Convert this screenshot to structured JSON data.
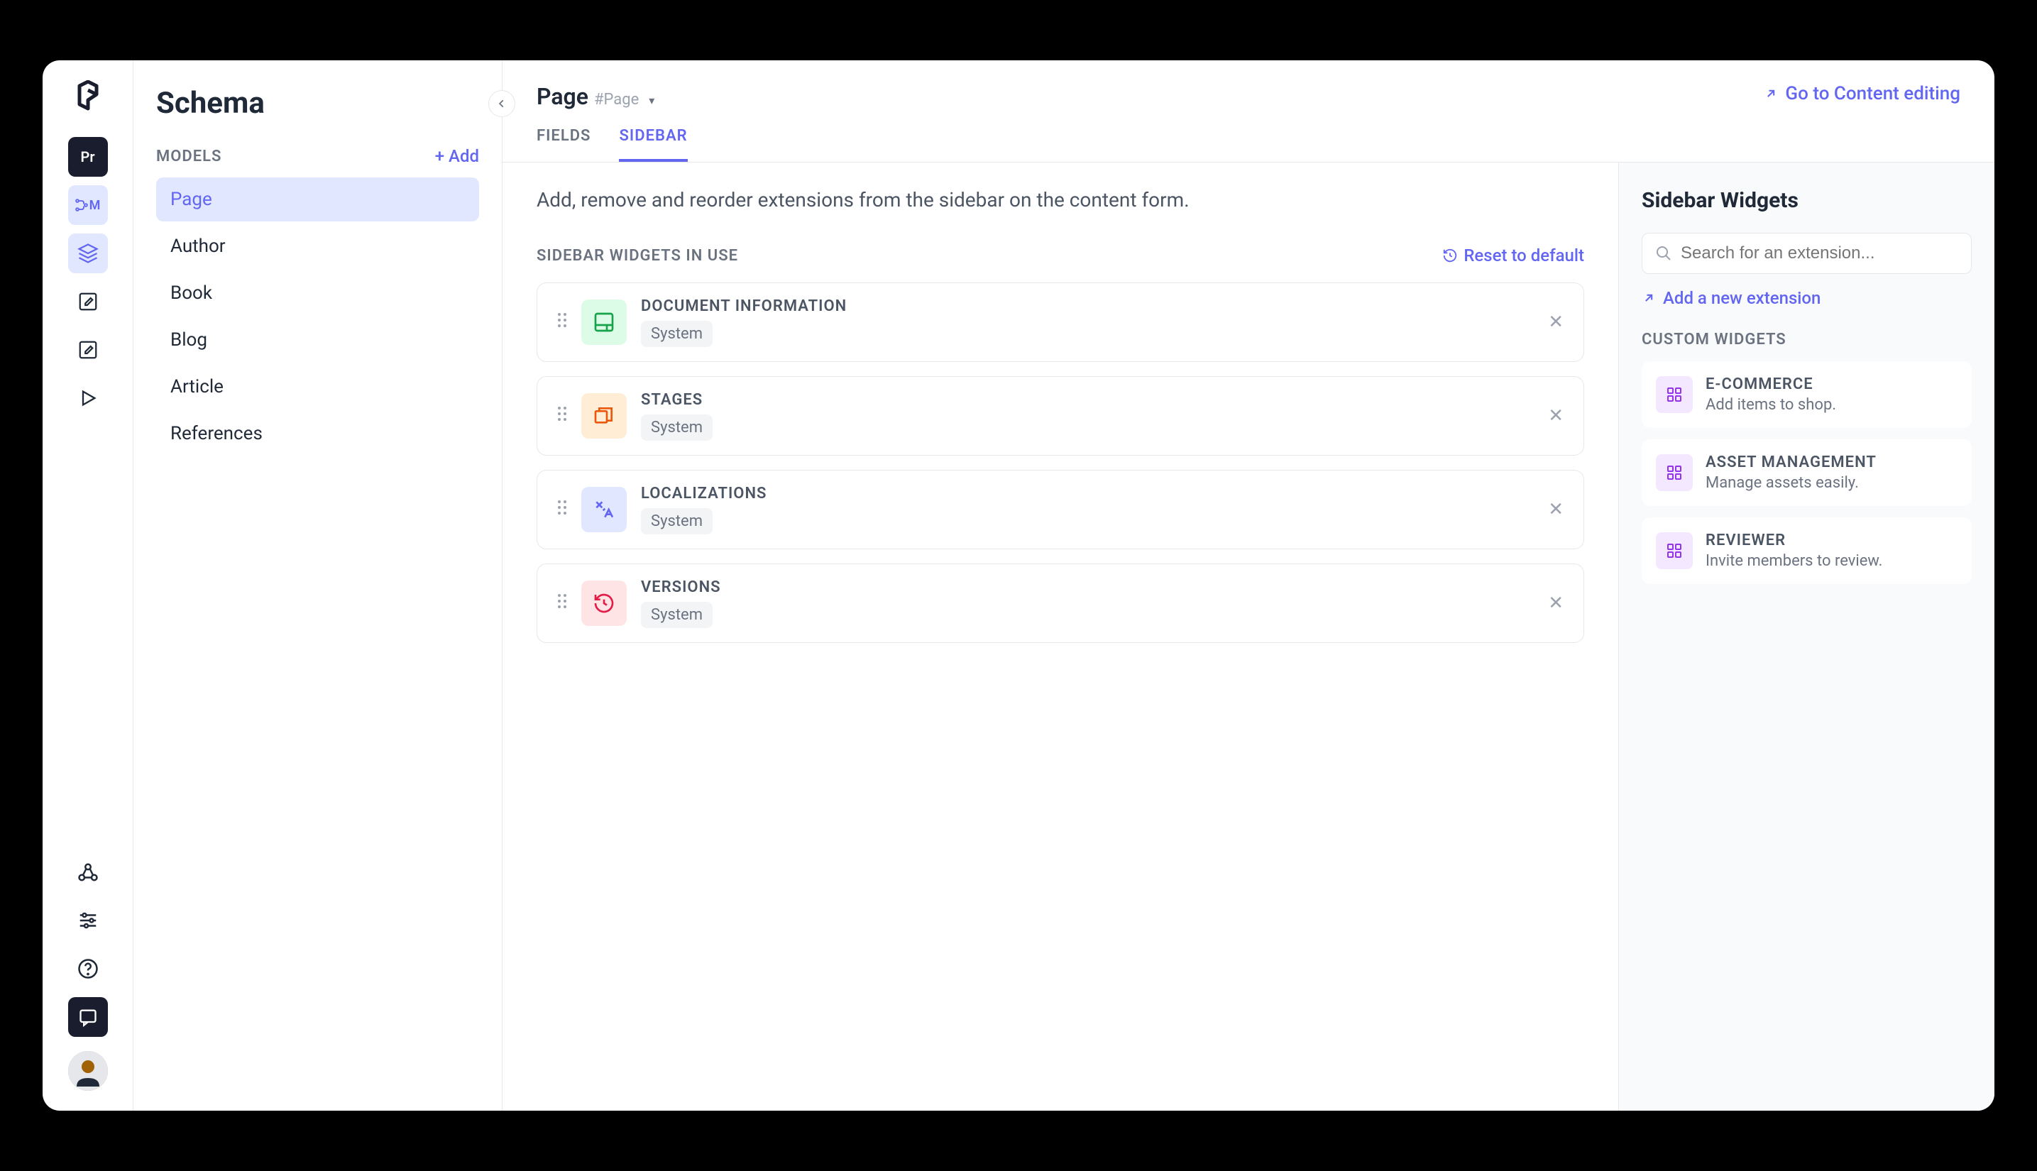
{
  "page_title": "Schema",
  "nav_badges": {
    "pr": "Pr",
    "m": "M"
  },
  "models": {
    "label": "MODELS",
    "add": "+ Add",
    "items": [
      "Page",
      "Author",
      "Book",
      "Blog",
      "Article",
      "References"
    ],
    "active_index": 0
  },
  "header": {
    "crumb_title": "Page",
    "crumb_tag": "#Page",
    "content_link": "Go to Content editing"
  },
  "tabs": {
    "items": [
      "FIELDS",
      "SIDEBAR"
    ],
    "active_index": 1
  },
  "center": {
    "intro": "Add, remove and reorder extensions from the sidebar on the content form.",
    "section_label": "SIDEBAR WIDGETS IN USE",
    "reset": "Reset to default",
    "widgets": [
      {
        "title": "DOCUMENT INFORMATION",
        "tag": "System",
        "icon_color": "#16a34a",
        "icon_bg": "#dcfce7"
      },
      {
        "title": "STAGES",
        "tag": "System",
        "icon_color": "#ea580c",
        "icon_bg": "#ffedd5"
      },
      {
        "title": "LOCALIZATIONS",
        "tag": "System",
        "icon_color": "#6366f1",
        "icon_bg": "#e0e7ff"
      },
      {
        "title": "VERSIONS",
        "tag": "System",
        "icon_color": "#e11d48",
        "icon_bg": "#ffe4e6"
      }
    ]
  },
  "right": {
    "title": "Sidebar Widgets",
    "search_placeholder": "Search for an extension...",
    "add_link": "Add a new extension",
    "custom_label": "CUSTOM WIDGETS",
    "custom": [
      {
        "title": "E-COMMERCE",
        "desc": "Add items to shop."
      },
      {
        "title": "ASSET MANAGEMENT",
        "desc": "Manage assets easily."
      },
      {
        "title": "REVIEWER",
        "desc": "Invite members to review."
      }
    ]
  }
}
